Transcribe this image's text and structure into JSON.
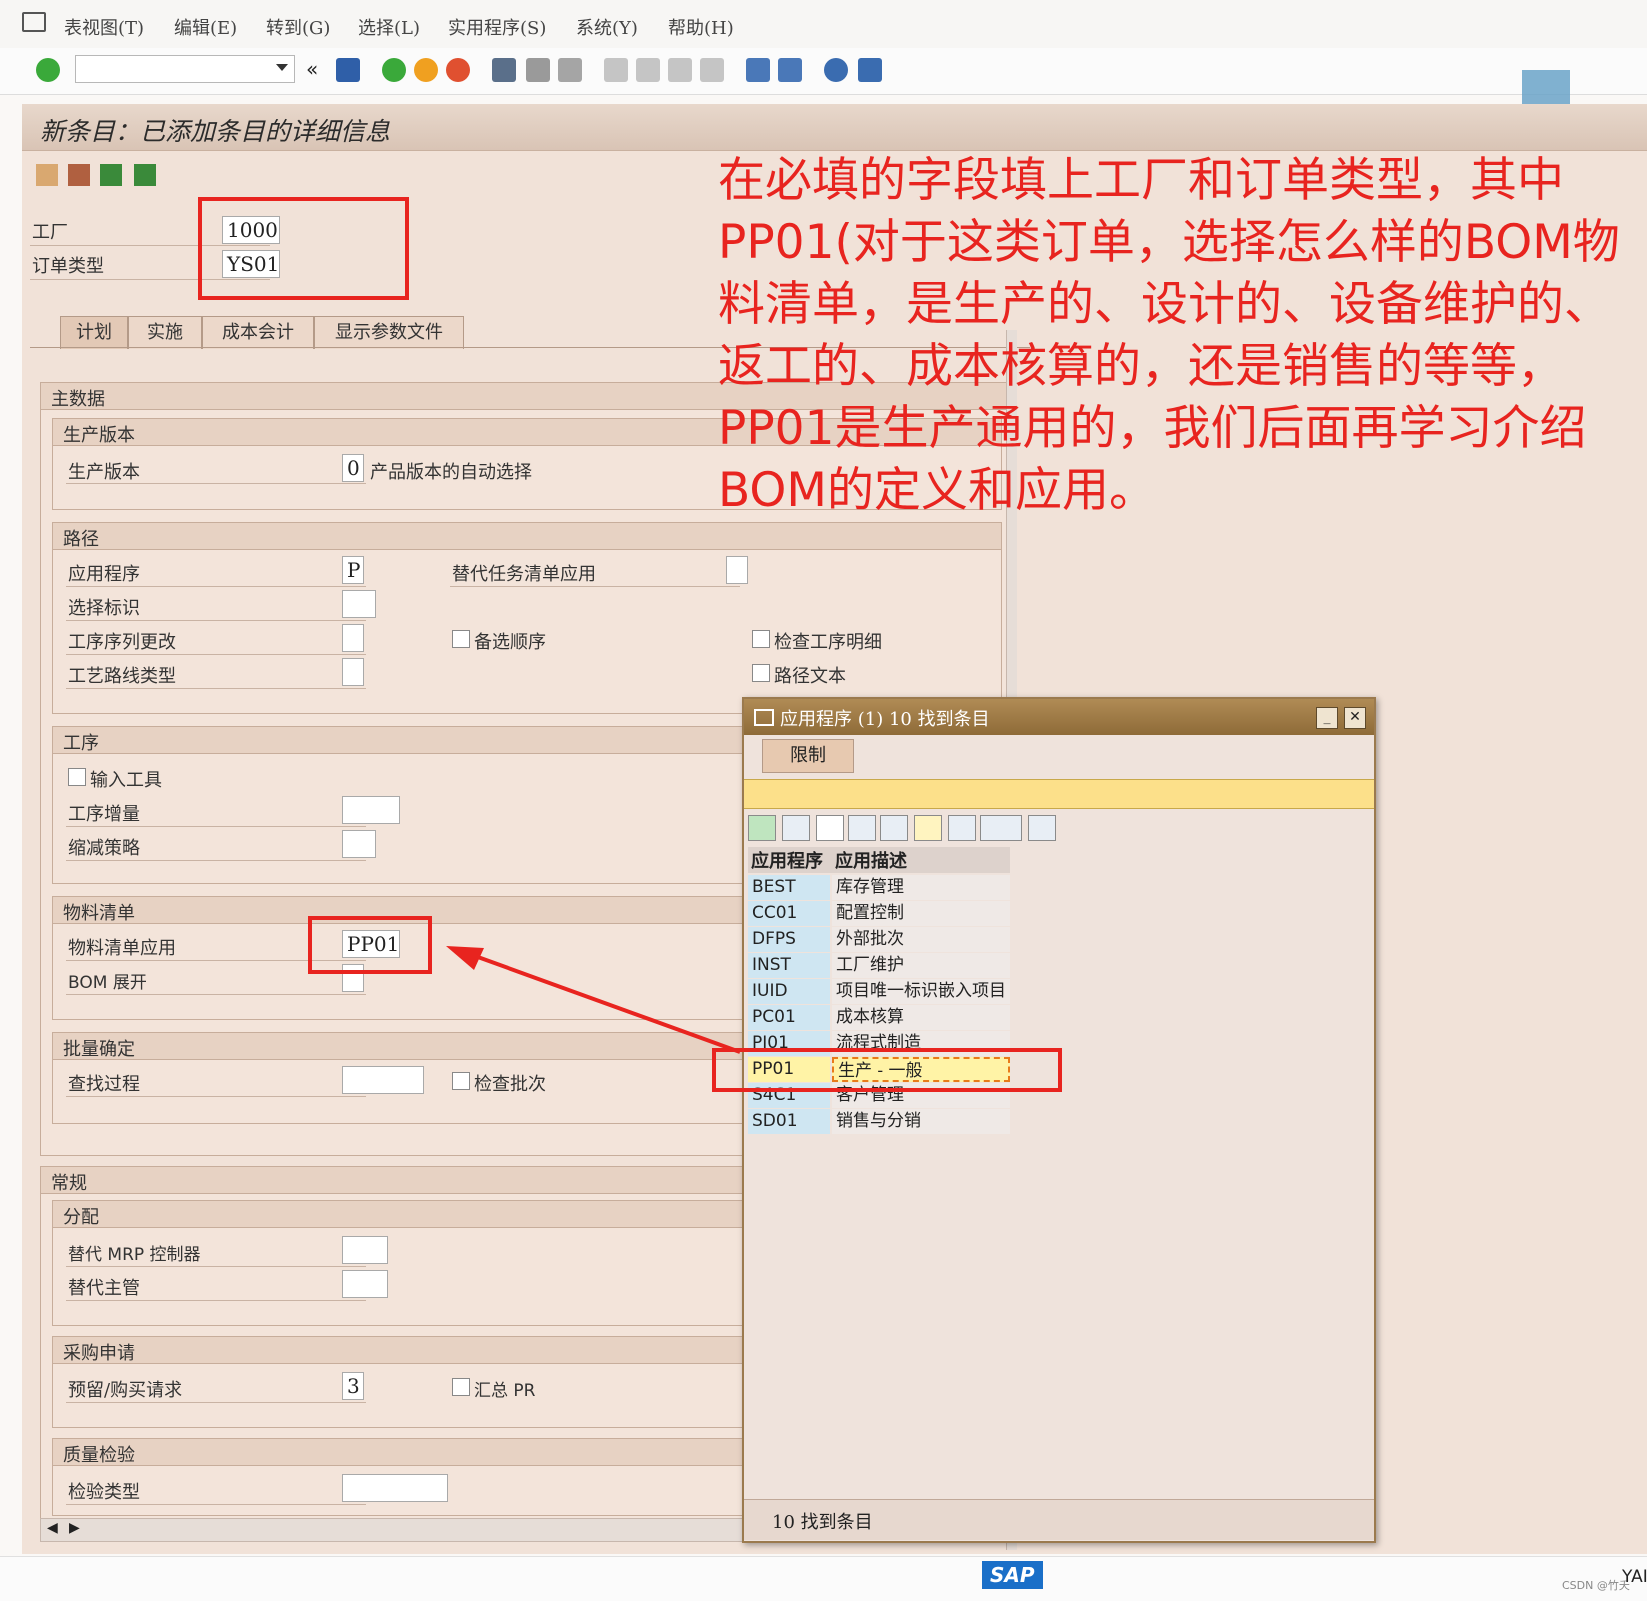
{
  "menubar": {
    "items": [
      "表视图(T)",
      "编辑(E)",
      "转到(G)",
      "选择(L)",
      "实用程序(S)",
      "系统(Y)",
      "帮助(H)"
    ]
  },
  "colors": {
    "accent_red": "#e8241f",
    "popup_title": "#9b7a4e",
    "panel_bg": "#f1e2d8"
  },
  "page": {
    "title": "新条目：已添加条目的详细信息"
  },
  "header_fields": {
    "plant_label": "工厂",
    "plant_value": "1000",
    "order_type_label": "订单类型",
    "order_type_value": "YS01"
  },
  "tabs": [
    "计划",
    "实施",
    "成本会计",
    "显示参数文件"
  ],
  "master_data": {
    "title": "主数据",
    "prod_version": {
      "title": "生产版本",
      "label": "生产版本",
      "value": "0",
      "desc": "产品版本的自动选择"
    },
    "routing": {
      "title": "路径",
      "app_label": "应用程序",
      "app_value": "P",
      "alt_task_label": "替代任务清单应用",
      "select_id_label": "选择标识",
      "op_seq_change_label": "工序序列更改",
      "alt_seq_label": "备选顺序",
      "check_op_detail_label": "检查工序明细",
      "routing_type_label": "工艺路线类型",
      "routing_text_label": "路径文本"
    },
    "operation": {
      "title": "工序",
      "input_tool_label": "输入工具",
      "op_increment_label": "工序增量",
      "reduction_label": "缩减策略"
    },
    "bom": {
      "title": "物料清单",
      "bom_app_label": "物料清单应用",
      "bom_app_value": "PP01",
      "bom_explode_label": "BOM 展开"
    },
    "batch": {
      "title": "批量确定",
      "search_label": "查找过程",
      "check_batch_label": "检查批次"
    }
  },
  "general": {
    "title": "常规",
    "assign": {
      "title": "分配",
      "alt_mrp_label": "替代 MRP 控制器",
      "alt_supervisor_label": "替代主管"
    },
    "purchase": {
      "title": "采购申请",
      "reservation_label": "预留/购买请求",
      "reservation_value": "3",
      "summary_pr_label": "汇总 PR"
    },
    "quality": {
      "title": "质量检验",
      "inspection_type_label": "检验类型"
    }
  },
  "annotation": {
    "text": "在必填的字段填上工厂和订单类型，其中PP01(对于这类订单，选择怎么样的BOM物料清单，是生产的、设计的、设备维护的、返工的、成本核算的，还是销售的等等，PP01是生产通用的，我们后面再学习介绍BOM的定义和应用。"
  },
  "popup": {
    "title": "应用程序 (1)   10 找到条目",
    "tab": "限制",
    "col_code": "应用程序",
    "col_desc": "应用描述",
    "rows": [
      {
        "code": "BEST",
        "desc": "库存管理"
      },
      {
        "code": "CC01",
        "desc": "配置控制"
      },
      {
        "code": "DFPS",
        "desc": "外部批次"
      },
      {
        "code": "INST",
        "desc": "工厂维护"
      },
      {
        "code": "IUID",
        "desc": "项目唯一标识嵌入项目"
      },
      {
        "code": "PC01",
        "desc": "成本核算"
      },
      {
        "code": "PI01",
        "desc": "流程式制造"
      },
      {
        "code": "PP01",
        "desc": "生产 - 一般"
      },
      {
        "code": "S4C1",
        "desc": "客户管理"
      },
      {
        "code": "SD01",
        "desc": "销售与分销"
      }
    ],
    "status": "10 找到条目"
  },
  "footer": {
    "logo": "SAP",
    "watermark": "CSDN @竹夭",
    "corner": "YAI"
  }
}
